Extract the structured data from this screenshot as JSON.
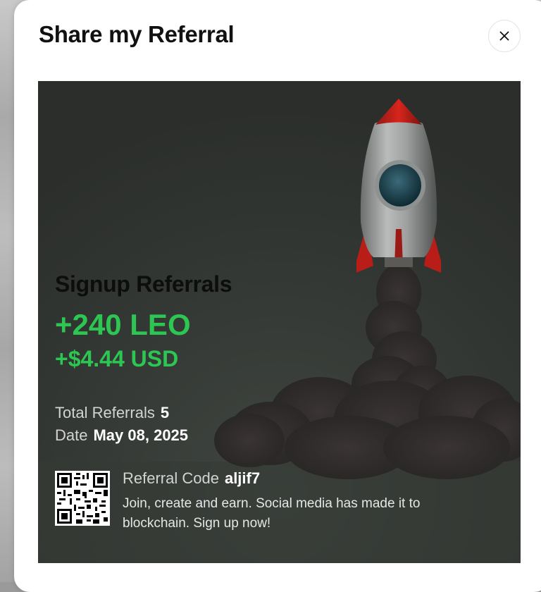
{
  "modal": {
    "title": "Share my Referral",
    "close_icon": "close-icon"
  },
  "card": {
    "image": "rocket-launch-image",
    "signup_title": "Signup Referrals",
    "leo_amount": "+240 LEO",
    "usd_amount": "+$4.44 USD",
    "total_referrals_label": "Total Referrals",
    "total_referrals_value": "5",
    "date_label": "Date",
    "date_value": "May 08, 2025",
    "qr_icon": "qr-code-icon",
    "referral_code_label": "Referral Code",
    "referral_code_value": "aljif7",
    "description": "Join, create and earn. Social media has made it to blockchain. Sign up now!"
  },
  "colors": {
    "accent_green": "#2dc653",
    "card_background": "#2e312e"
  }
}
